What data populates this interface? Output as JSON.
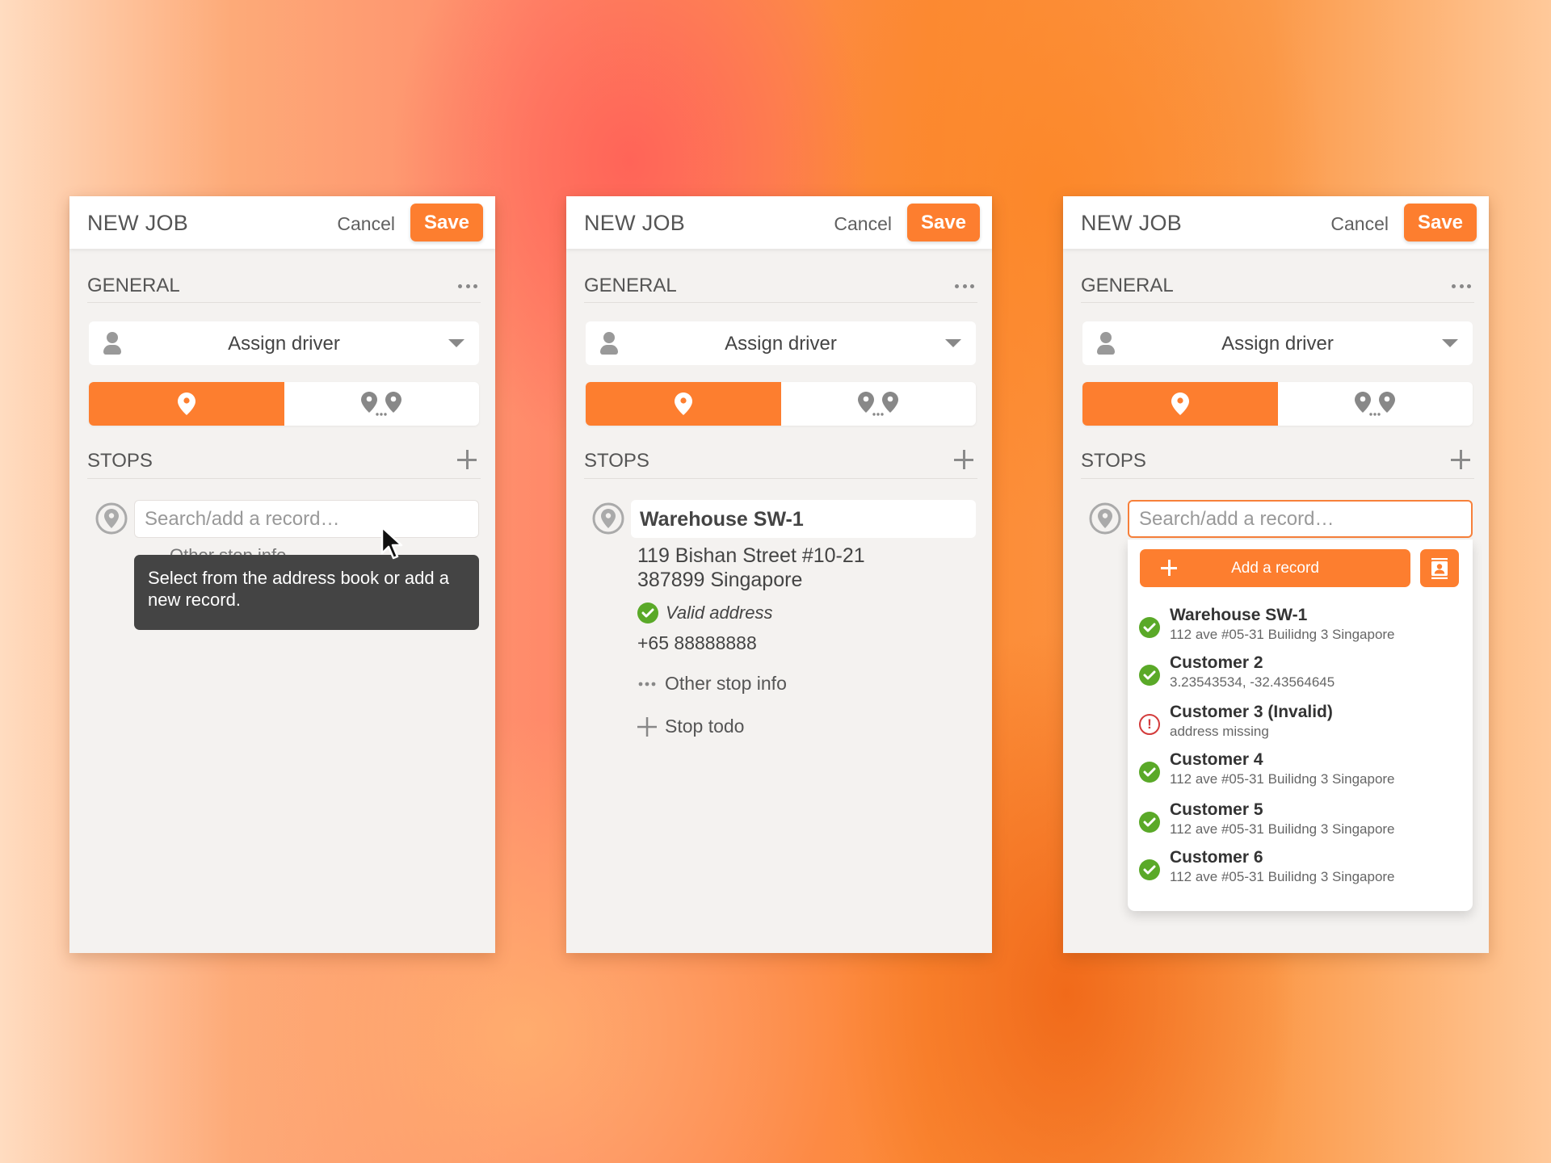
{
  "colors": {
    "accent": "#fd7e2f",
    "valid": "#5aa928",
    "invalid": "#d33b3b",
    "tooltip_bg": "#444444"
  },
  "panels": [
    {
      "header": {
        "title": "NEW JOB",
        "cancel_label": "Cancel",
        "save_label": "Save"
      },
      "general": {
        "title": "GENERAL",
        "more_icon": "more-horizontal-icon",
        "driver_label": "Assign driver"
      },
      "mode_toggle": {
        "options": [
          "single-stop-icon",
          "multi-stop-icon"
        ],
        "selected": 0
      },
      "stops": {
        "title": "STOPS",
        "search_placeholder": "Search/add a record…",
        "hidden_text": "Other stop info"
      },
      "tooltip": "Select from the address book or add a new record."
    },
    {
      "header": {
        "title": "NEW JOB",
        "cancel_label": "Cancel",
        "save_label": "Save"
      },
      "general": {
        "title": "GENERAL",
        "driver_label": "Assign driver"
      },
      "mode_toggle": {
        "selected": 0
      },
      "stops": {
        "title": "STOPS",
        "stop": {
          "name": "Warehouse SW-1",
          "address_line1": "119 Bishan Street #10-21",
          "address_line2": "387899 Singapore",
          "status": "Valid address",
          "phone": "+65 88888888",
          "other_info_label": "Other stop info",
          "todo_label": "Stop todo"
        }
      }
    },
    {
      "header": {
        "title": "NEW JOB",
        "cancel_label": "Cancel",
        "save_label": "Save"
      },
      "general": {
        "title": "GENERAL",
        "driver_label": "Assign driver"
      },
      "mode_toggle": {
        "selected": 0
      },
      "stops": {
        "title": "STOPS",
        "search_placeholder": "Search/add a record…",
        "add_record_label": "Add a record",
        "records": [
          {
            "name": "Warehouse SW-1",
            "detail": "112 ave #05-31 Builidng 3 Singapore",
            "status": "valid"
          },
          {
            "name": "Customer 2",
            "detail": "3.23543534, -32.43564645",
            "status": "valid"
          },
          {
            "name": "Customer 3 (Invalid)",
            "detail": "address missing",
            "status": "invalid"
          },
          {
            "name": "Customer 4",
            "detail": "112 ave #05-31 Builidng 3 Singapore",
            "status": "valid"
          },
          {
            "name": "Customer 5",
            "detail": "112 ave #05-31 Builidng 3 Singapore",
            "status": "valid"
          },
          {
            "name": "Customer 6",
            "detail": "112 ave #05-31 Builidng 3 Singapore",
            "status": "valid"
          }
        ]
      }
    }
  ]
}
